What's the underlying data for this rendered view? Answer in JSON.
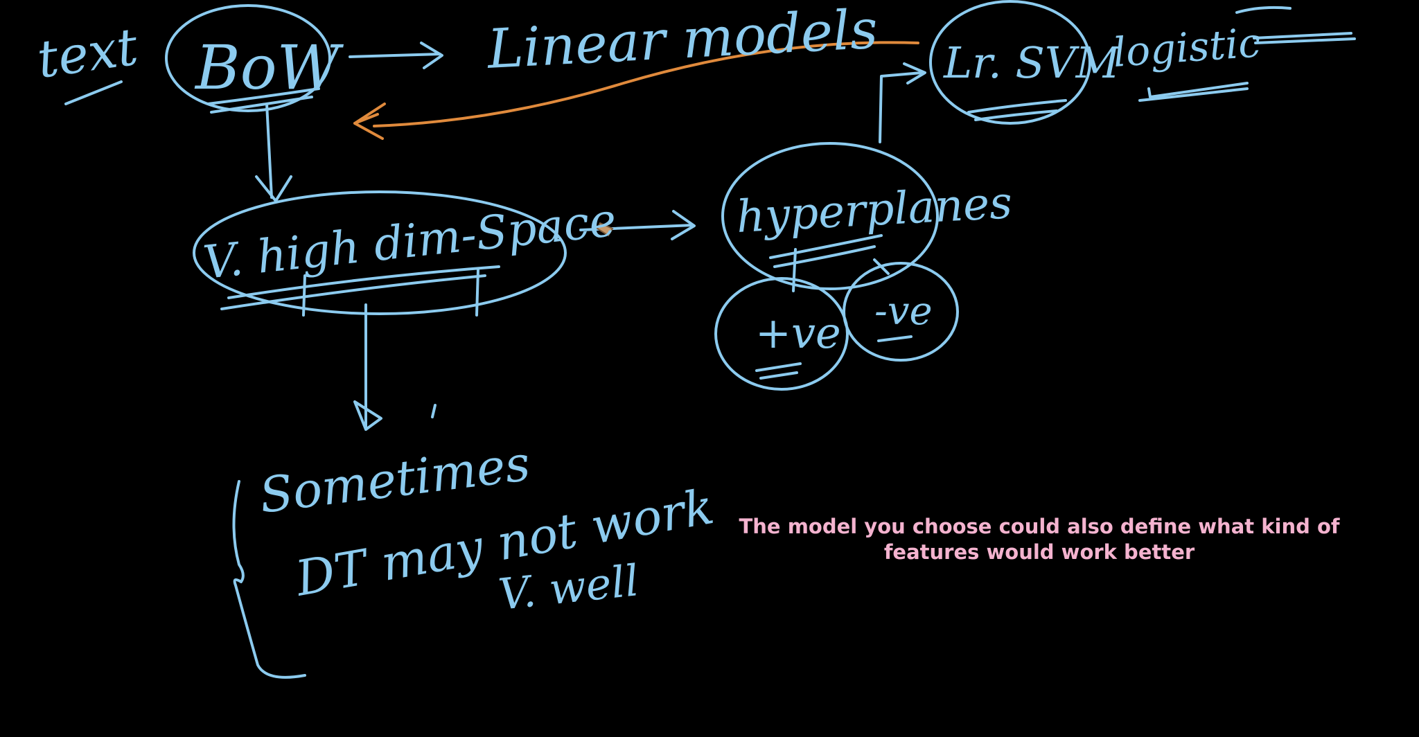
{
  "whiteboard": {
    "ink_color": "#8ccbef",
    "arrow_color": "#e08a3c",
    "background": "#000000",
    "labels": {
      "text": "text",
      "bow": "BoW",
      "linear_models": "Linear models",
      "lr_svm": "Lr. SVM",
      "logistic": "logistic",
      "high_dim": "V. high dim-Space",
      "hyperplanes": "hyperplanes",
      "positive": "+ve",
      "negative": "-ve",
      "sometimes": "Sometimes",
      "dt_may_not_work": "DT may not work",
      "v_well": "V. well"
    }
  },
  "caption": {
    "text": "The model you choose could also define what kind of features would work better",
    "color": "#f4b3cf"
  }
}
